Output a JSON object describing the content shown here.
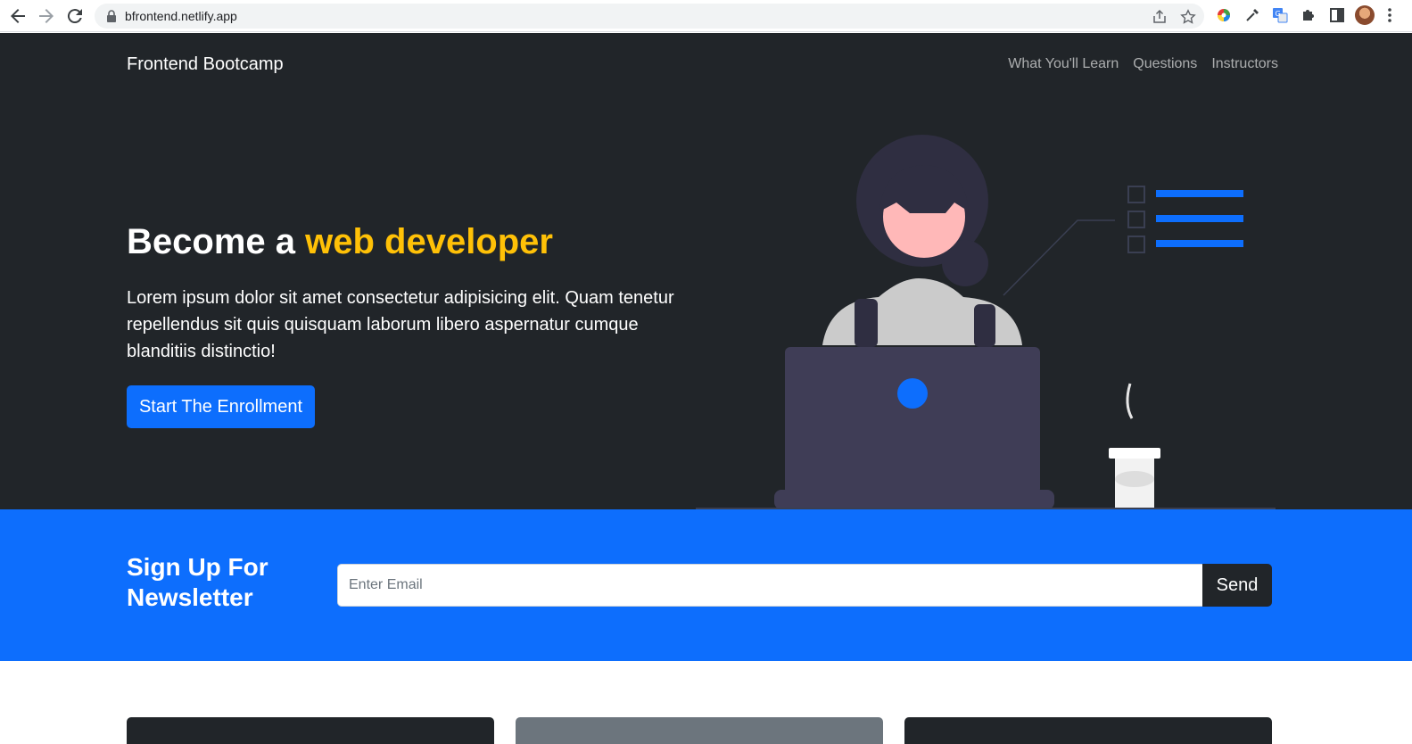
{
  "browser": {
    "url": "bfrontend.netlify.app",
    "icons": [
      "back-arrow-icon",
      "forward-arrow-icon",
      "reload-icon",
      "lock-icon",
      "share-icon",
      "star-icon",
      "color-picker-extension-icon",
      "eyedropper-extension-icon",
      "translate-extension-icon",
      "puzzle-extensions-icon",
      "side-panel-icon",
      "profile-avatar",
      "kebab-menu-icon"
    ]
  },
  "navbar": {
    "brand": "Frontend Bootcamp",
    "links": [
      "What You'll Learn",
      "Questions",
      "Instructors"
    ]
  },
  "hero": {
    "headline_prefix": "Become a ",
    "headline_accent": "web developer",
    "lead": "Lorem ipsum dolor sit amet consectetur adipisicing elit. Quam tenetur repellendus sit quis quisquam laborum libero aspernatur cumque blanditiis distinctio!",
    "cta_label": "Start The Enrollment"
  },
  "newsletter": {
    "title": "Sign Up For Newsletter",
    "input_placeholder": "Enter Email",
    "input_value": "",
    "send_label": "Send"
  },
  "colors": {
    "dark": "#212529",
    "primary": "#0d6efd",
    "warning": "#ffc107",
    "card_secondary": "#6c757d"
  }
}
